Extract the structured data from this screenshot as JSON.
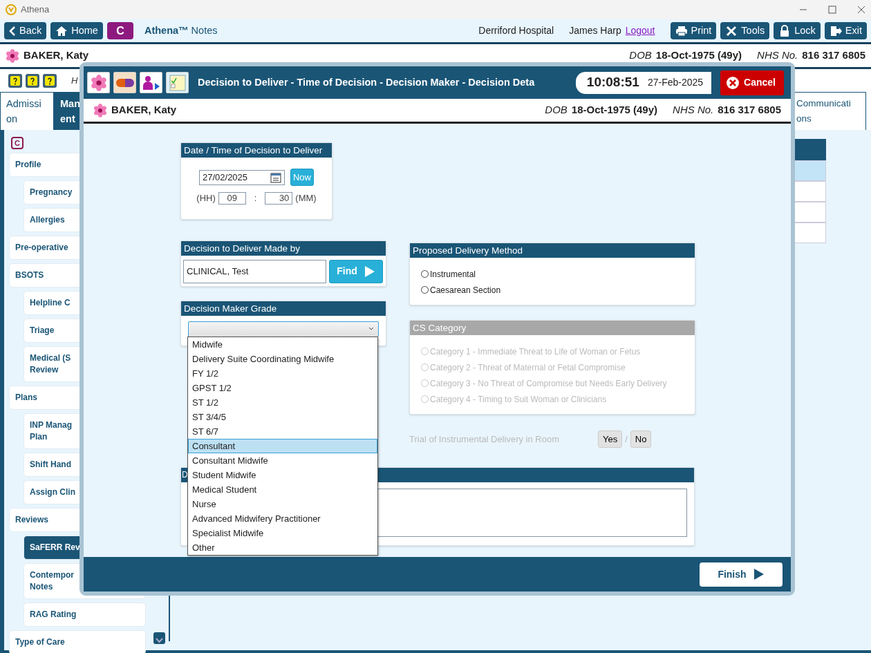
{
  "window": {
    "title": "Athena"
  },
  "toolbar": {
    "left_buttons": [
      {
        "label": "Back",
        "kind": "back"
      },
      {
        "label": "Home",
        "kind": "home"
      }
    ],
    "c_button": "C",
    "app_name": "**Athena™** Notes",
    "hospital": "Derriford Hospital",
    "user": "James Harp",
    "logout": "Logout",
    "right_buttons": [
      {
        "label": "Print",
        "kind": "print"
      },
      {
        "label": "Tools",
        "kind": "tools"
      },
      {
        "label": "Lock",
        "kind": "lock"
      },
      {
        "label": "Exit",
        "kind": "exit"
      }
    ]
  },
  "patient": {
    "name": "BAKER, Katy",
    "dob_label": "DOB",
    "dob": "18-Oct-1975 (49y)",
    "nhs_label": "NHS No.",
    "nhs": "816 317 6805"
  },
  "hint_text": "H",
  "tabs": [
    {
      "label": "Admissi\non",
      "selected": false
    },
    {
      "label": "Man\nent",
      "selected": true
    },
    {
      "label": "Communicati\nons",
      "selected": false
    }
  ],
  "sidebar": {
    "badge": "C",
    "items": [
      {
        "label": "Profile",
        "selected": false,
        "children": [
          {
            "label": "Pregnancy",
            "selected": false
          },
          {
            "label": "Allergies",
            "selected": false
          }
        ]
      },
      {
        "label": "Pre-operative",
        "selected": false
      },
      {
        "label": "BSOTS",
        "selected": false,
        "children": [
          {
            "label": "Helpline C",
            "selected": false
          },
          {
            "label": "Triage",
            "selected": false
          },
          {
            "label": "Medical (S\nReview",
            "selected": false
          }
        ]
      },
      {
        "label": "Plans",
        "selected": false,
        "children": [
          {
            "label": "INP Manag\nPlan",
            "selected": false
          },
          {
            "label": "Shift Hand",
            "selected": false
          },
          {
            "label": "Assign Clin",
            "selected": false
          }
        ]
      },
      {
        "label": "Reviews",
        "selected": false,
        "children": [
          {
            "label": "SaFERR Rev",
            "selected": true
          },
          {
            "label": "Contempor\nNotes",
            "selected": false
          },
          {
            "label": "RAG Rating",
            "selected": false
          }
        ]
      },
      {
        "label": "Type of Care",
        "selected": false
      }
    ]
  },
  "side_table_rows": [
    {
      "selected": true
    },
    {
      "selected": false
    },
    {
      "selected": false
    },
    {
      "selected": false
    }
  ],
  "dialog": {
    "title": "Decision to Deliver - Time of Decision - Decision Maker - Decision Deta",
    "time": "10:08:51",
    "date": "27-Feb-2025",
    "cancel": "Cancel",
    "patient": {
      "name": "BAKER, Katy",
      "dob_label": "DOB",
      "dob": "18-Oct-1975 (49y)",
      "nhs_label": "NHS No.",
      "nhs": "816 317 6805"
    },
    "date_card": {
      "heading": "Date / Time of Decision to Deliver",
      "date": "27/02/2025",
      "now": "Now",
      "hh_label": "(HH)",
      "hh": "09",
      "separator": ":",
      "mm": "30",
      "mm_label": "(MM)"
    },
    "made_by": {
      "heading": "Decision to Deliver Made by",
      "value": "CLINICAL, Test",
      "find": "Find"
    },
    "grade": {
      "heading": "Decision Maker Grade",
      "expanded": true,
      "options": [
        {
          "label": "Midwife",
          "selected": false
        },
        {
          "label": "Delivery Suite Coordinating Midwife",
          "selected": false
        },
        {
          "label": "FY 1/2",
          "selected": false
        },
        {
          "label": "GPST 1/2",
          "selected": false
        },
        {
          "label": "ST 1/2",
          "selected": false
        },
        {
          "label": "ST 3/4/5",
          "selected": false
        },
        {
          "label": "ST 6/7",
          "selected": false
        },
        {
          "label": "Consultant",
          "selected": true
        },
        {
          "label": "Consultant Midwife",
          "selected": false
        },
        {
          "label": "Student Midwife",
          "selected": false
        },
        {
          "label": "Medical Student",
          "selected": false
        },
        {
          "label": "Nurse",
          "selected": false
        },
        {
          "label": "Advanced Midwifery Practitioner",
          "selected": false
        },
        {
          "label": "Specialist Midwife",
          "selected": false
        },
        {
          "label": "Other",
          "selected": false
        }
      ]
    },
    "delivery_method": {
      "heading": "Proposed Delivery Method",
      "disabled": false,
      "options": [
        {
          "label": "Instrumental",
          "selected": false
        },
        {
          "label": "Caesarean Section",
          "selected": false
        }
      ]
    },
    "cs_category": {
      "heading": "CS Category",
      "disabled": true,
      "options": [
        {
          "label": "Category 1 - Immediate Threat to Life of Woman or Fetus",
          "selected": false
        },
        {
          "label": "Category 2 - Threat of Maternal or Fetal Compromise",
          "selected": false
        },
        {
          "label": "Category 3 - No Threat of Compromise but Needs Early Delivery",
          "selected": false
        },
        {
          "label": "Category 4 - Timing to Suit Woman or Clinicians",
          "selected": false
        }
      ]
    },
    "trial": {
      "label": "Trial of Instrumental Delivery in Room",
      "yes": "Yes",
      "separator": "/",
      "no": "No",
      "disabled": true
    },
    "comments": {
      "heading": "D"
    },
    "finish": "Finish"
  }
}
